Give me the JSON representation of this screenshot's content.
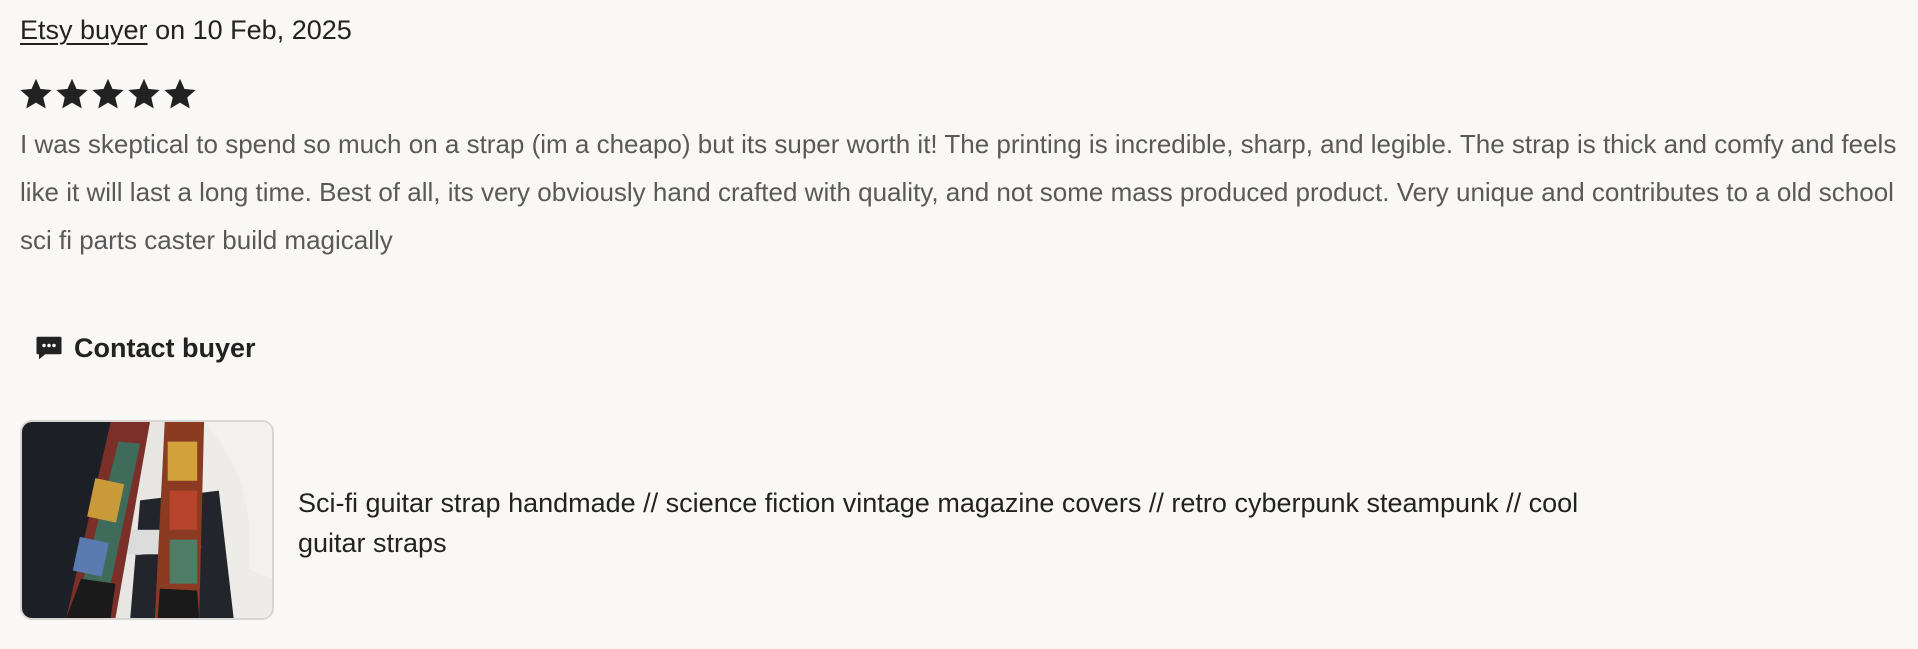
{
  "review": {
    "buyer_name": "Etsy buyer",
    "date_prefix": "on",
    "date": "10 Feb, 2025",
    "rating": 5,
    "rating_max": 5,
    "text": "I was skeptical to spend so much on a strap (im a cheapo) but its super worth it! The printing is incredible, sharp, and legible. The strap is thick and comfy and feels like it will last a long time. Best of all, its very obviously hand crafted with quality, and not some mass produced product. Very unique and contributes to a old school sci fi parts caster build magically"
  },
  "actions": {
    "contact_label": "Contact buyer",
    "contact_icon": "chat-bubble-icon"
  },
  "listing": {
    "title": "Sci-fi guitar strap handmade // science fiction vintage magazine covers // retro cyberpunk steampunk // cool guitar straps"
  },
  "colors": {
    "background": "#f9f8f6",
    "text_primary": "#222222",
    "text_secondary": "#595959",
    "star": "#222222"
  }
}
